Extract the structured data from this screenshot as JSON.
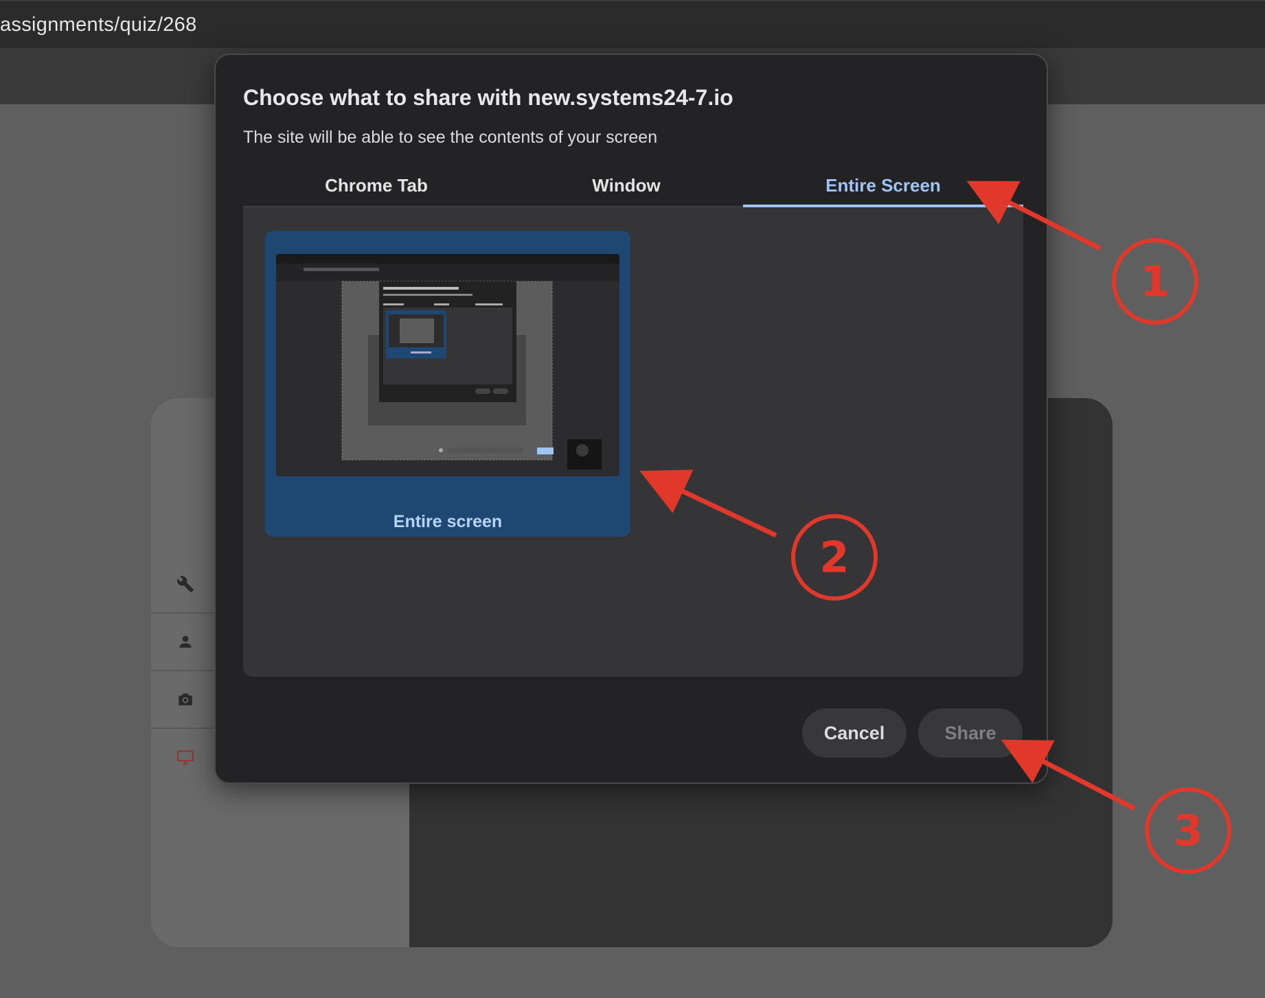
{
  "browser": {
    "url": "assignments/quiz/268"
  },
  "dialog": {
    "title": "Choose what to share with new.systems24-7.io",
    "subtitle": "The site will be able to see the contents of your screen",
    "tabs": [
      {
        "label": "Chrome Tab",
        "active": false
      },
      {
        "label": "Window",
        "active": false
      },
      {
        "label": "Entire Screen",
        "active": true
      }
    ],
    "source": {
      "label": "Entire screen",
      "selected": true
    },
    "buttons": {
      "cancel": "Cancel",
      "share": "Share"
    }
  },
  "background_app": {
    "sidebar_icons": [
      "wrench-icon",
      "person-icon",
      "camera-icon",
      "monitor-icon"
    ]
  },
  "annotations": [
    {
      "number": "1"
    },
    {
      "number": "2"
    },
    {
      "number": "3"
    }
  ],
  "colors": {
    "accent_blue": "#9ec5f5",
    "selected_card": "#1e4772",
    "annotation_red": "#e0392b",
    "dialog_bg": "#232325"
  }
}
